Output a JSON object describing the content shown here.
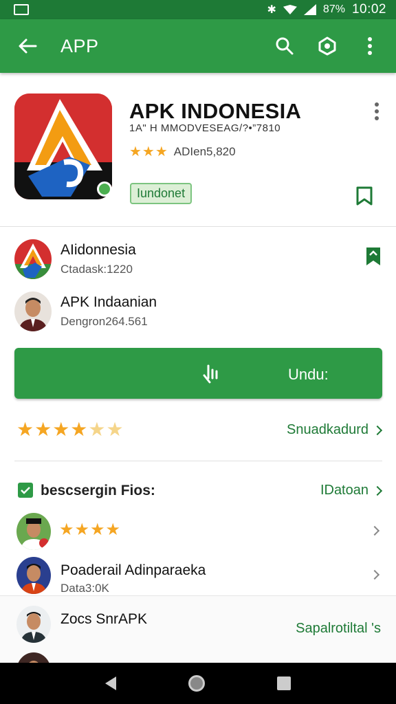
{
  "status_bar": {
    "time": "10:02",
    "battery": "87%"
  },
  "app_bar": {
    "title": "APP"
  },
  "app": {
    "name": "APK INDONESIA",
    "subtitle": "1A\" H MMODVESEAG/?•”7810",
    "stars": "★★★",
    "rating_text": "ADIen5,820",
    "tag": "Iundonet"
  },
  "developers": [
    {
      "name": "AIidonnesia",
      "sub": "Ctadask:1220"
    },
    {
      "name": "APK Indaanian",
      "sub": "Dengron264.561"
    }
  ],
  "download": {
    "label": "Undu:"
  },
  "rating_summary": {
    "stars_full": "★★★★",
    "stars_half": "★★",
    "link": "Snuadkadurd"
  },
  "reviews": {
    "title": "bescsergin Fios:",
    "link": "IDatoan",
    "items": [
      {
        "stars": "★★★★"
      },
      {
        "name": "Poaderail Adinparaeka",
        "sub": "Data3:0K"
      },
      {
        "name": "Zocs SnrAPK",
        "link": "Sapalrotiltal 's"
      }
    ]
  },
  "colors": {
    "primary": "#2e9a46",
    "primary_dark": "#1e7a36",
    "star": "#f5a623"
  }
}
